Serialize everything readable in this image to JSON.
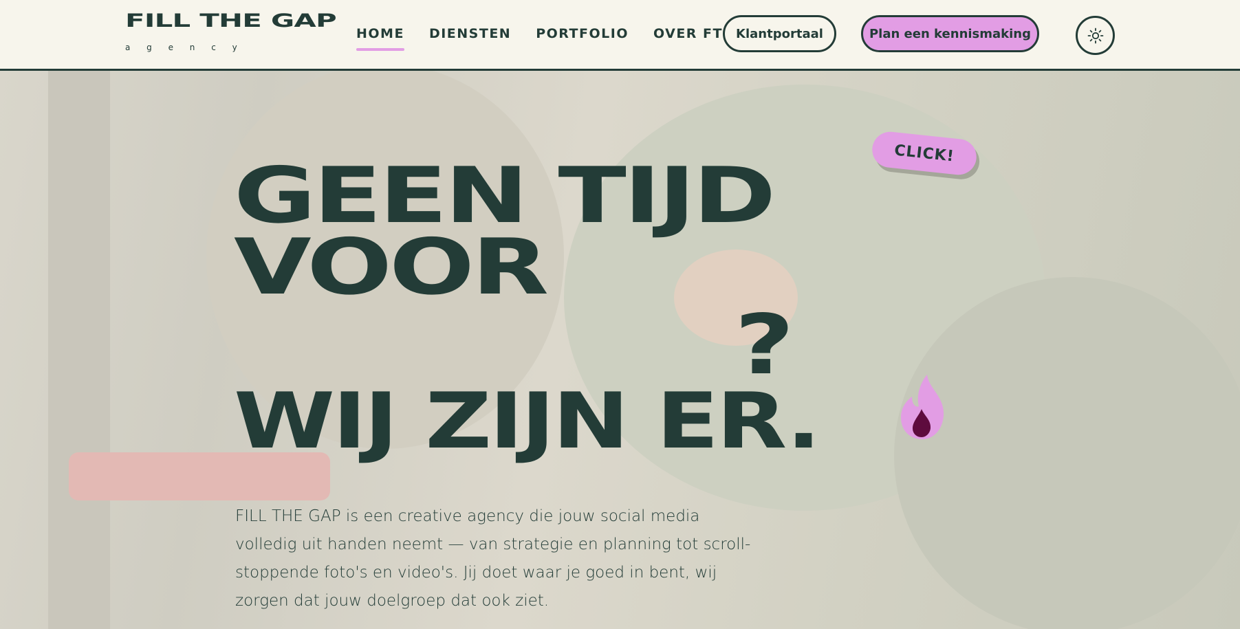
{
  "logo": {
    "name": "FILL THE GAP",
    "tagline": "a g e n c y"
  },
  "nav": {
    "items": [
      {
        "label": "HOME",
        "active": true
      },
      {
        "label": "DIENSTEN",
        "active": false
      },
      {
        "label": "PORTFOLIO",
        "active": false
      },
      {
        "label": "OVER FTG",
        "active": false
      }
    ]
  },
  "header": {
    "portal_label": "Klantportaal",
    "cta_label": "Plan een kennismaking",
    "theme_icon": "sun-icon"
  },
  "hero": {
    "line1": "GEEN TIJD",
    "line2": "VOOR",
    "question_mark": "?",
    "line3": "WIJ ZIJN ER.",
    "sticker": "CLICK!",
    "flame_icon": "flame-icon",
    "description": "FILL THE GAP is een creative agency die jouw social media volledig uit handen neemt — van strategie en planning tot scroll-stoppende foto's en video's. Jij doet waar je goed in bent, wij zorgen dat jouw doelgroep dat ook ziet."
  },
  "colors": {
    "primary": "#233c37",
    "accent": "#e29de4",
    "background": "#f7f5ec",
    "flame_inner": "#5e0b3e"
  }
}
